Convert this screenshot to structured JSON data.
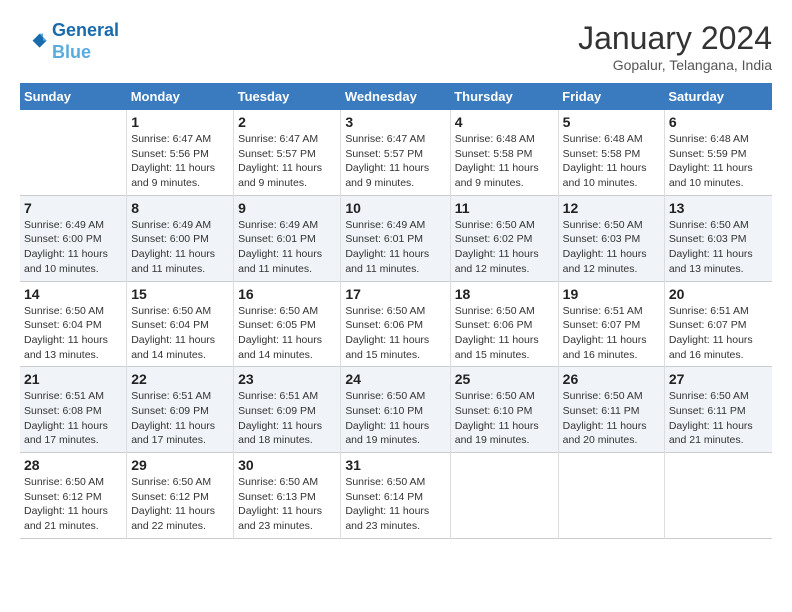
{
  "header": {
    "logo_line1": "General",
    "logo_line2": "Blue",
    "title": "January 2024",
    "subtitle": "Gopalur, Telangana, India"
  },
  "columns": [
    "Sunday",
    "Monday",
    "Tuesday",
    "Wednesday",
    "Thursday",
    "Friday",
    "Saturday"
  ],
  "weeks": [
    {
      "alt": false,
      "days": [
        {
          "num": "",
          "info": ""
        },
        {
          "num": "1",
          "info": "Sunrise: 6:47 AM\nSunset: 5:56 PM\nDaylight: 11 hours\nand 9 minutes."
        },
        {
          "num": "2",
          "info": "Sunrise: 6:47 AM\nSunset: 5:57 PM\nDaylight: 11 hours\nand 9 minutes."
        },
        {
          "num": "3",
          "info": "Sunrise: 6:47 AM\nSunset: 5:57 PM\nDaylight: 11 hours\nand 9 minutes."
        },
        {
          "num": "4",
          "info": "Sunrise: 6:48 AM\nSunset: 5:58 PM\nDaylight: 11 hours\nand 9 minutes."
        },
        {
          "num": "5",
          "info": "Sunrise: 6:48 AM\nSunset: 5:58 PM\nDaylight: 11 hours\nand 10 minutes."
        },
        {
          "num": "6",
          "info": "Sunrise: 6:48 AM\nSunset: 5:59 PM\nDaylight: 11 hours\nand 10 minutes."
        }
      ]
    },
    {
      "alt": true,
      "days": [
        {
          "num": "7",
          "info": "Sunrise: 6:49 AM\nSunset: 6:00 PM\nDaylight: 11 hours\nand 10 minutes."
        },
        {
          "num": "8",
          "info": "Sunrise: 6:49 AM\nSunset: 6:00 PM\nDaylight: 11 hours\nand 11 minutes."
        },
        {
          "num": "9",
          "info": "Sunrise: 6:49 AM\nSunset: 6:01 PM\nDaylight: 11 hours\nand 11 minutes."
        },
        {
          "num": "10",
          "info": "Sunrise: 6:49 AM\nSunset: 6:01 PM\nDaylight: 11 hours\nand 11 minutes."
        },
        {
          "num": "11",
          "info": "Sunrise: 6:50 AM\nSunset: 6:02 PM\nDaylight: 11 hours\nand 12 minutes."
        },
        {
          "num": "12",
          "info": "Sunrise: 6:50 AM\nSunset: 6:03 PM\nDaylight: 11 hours\nand 12 minutes."
        },
        {
          "num": "13",
          "info": "Sunrise: 6:50 AM\nSunset: 6:03 PM\nDaylight: 11 hours\nand 13 minutes."
        }
      ]
    },
    {
      "alt": false,
      "days": [
        {
          "num": "14",
          "info": "Sunrise: 6:50 AM\nSunset: 6:04 PM\nDaylight: 11 hours\nand 13 minutes."
        },
        {
          "num": "15",
          "info": "Sunrise: 6:50 AM\nSunset: 6:04 PM\nDaylight: 11 hours\nand 14 minutes."
        },
        {
          "num": "16",
          "info": "Sunrise: 6:50 AM\nSunset: 6:05 PM\nDaylight: 11 hours\nand 14 minutes."
        },
        {
          "num": "17",
          "info": "Sunrise: 6:50 AM\nSunset: 6:06 PM\nDaylight: 11 hours\nand 15 minutes."
        },
        {
          "num": "18",
          "info": "Sunrise: 6:50 AM\nSunset: 6:06 PM\nDaylight: 11 hours\nand 15 minutes."
        },
        {
          "num": "19",
          "info": "Sunrise: 6:51 AM\nSunset: 6:07 PM\nDaylight: 11 hours\nand 16 minutes."
        },
        {
          "num": "20",
          "info": "Sunrise: 6:51 AM\nSunset: 6:07 PM\nDaylight: 11 hours\nand 16 minutes."
        }
      ]
    },
    {
      "alt": true,
      "days": [
        {
          "num": "21",
          "info": "Sunrise: 6:51 AM\nSunset: 6:08 PM\nDaylight: 11 hours\nand 17 minutes."
        },
        {
          "num": "22",
          "info": "Sunrise: 6:51 AM\nSunset: 6:09 PM\nDaylight: 11 hours\nand 17 minutes."
        },
        {
          "num": "23",
          "info": "Sunrise: 6:51 AM\nSunset: 6:09 PM\nDaylight: 11 hours\nand 18 minutes."
        },
        {
          "num": "24",
          "info": "Sunrise: 6:50 AM\nSunset: 6:10 PM\nDaylight: 11 hours\nand 19 minutes."
        },
        {
          "num": "25",
          "info": "Sunrise: 6:50 AM\nSunset: 6:10 PM\nDaylight: 11 hours\nand 19 minutes."
        },
        {
          "num": "26",
          "info": "Sunrise: 6:50 AM\nSunset: 6:11 PM\nDaylight: 11 hours\nand 20 minutes."
        },
        {
          "num": "27",
          "info": "Sunrise: 6:50 AM\nSunset: 6:11 PM\nDaylight: 11 hours\nand 21 minutes."
        }
      ]
    },
    {
      "alt": false,
      "days": [
        {
          "num": "28",
          "info": "Sunrise: 6:50 AM\nSunset: 6:12 PM\nDaylight: 11 hours\nand 21 minutes."
        },
        {
          "num": "29",
          "info": "Sunrise: 6:50 AM\nSunset: 6:12 PM\nDaylight: 11 hours\nand 22 minutes."
        },
        {
          "num": "30",
          "info": "Sunrise: 6:50 AM\nSunset: 6:13 PM\nDaylight: 11 hours\nand 23 minutes."
        },
        {
          "num": "31",
          "info": "Sunrise: 6:50 AM\nSunset: 6:14 PM\nDaylight: 11 hours\nand 23 minutes."
        },
        {
          "num": "",
          "info": ""
        },
        {
          "num": "",
          "info": ""
        },
        {
          "num": "",
          "info": ""
        }
      ]
    }
  ]
}
